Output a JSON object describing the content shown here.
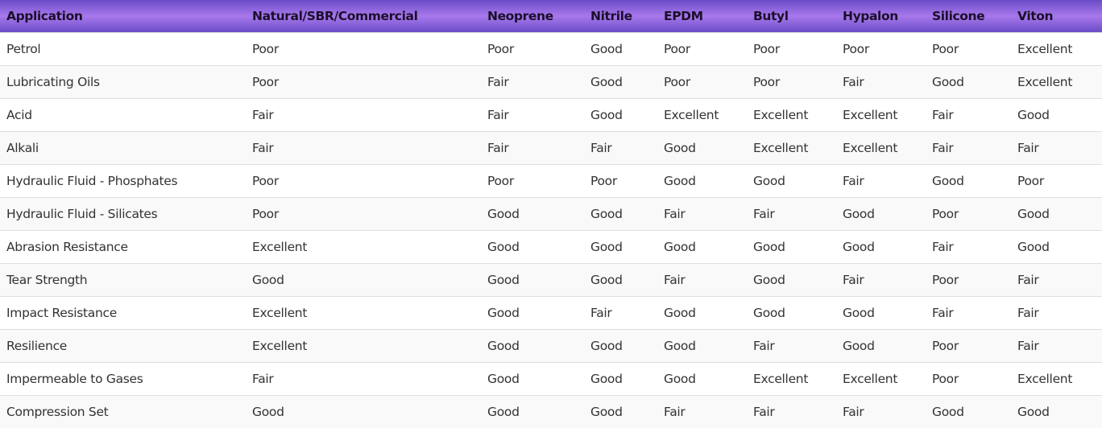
{
  "table": {
    "headers": [
      "Application",
      "Natural/SBR/Commercial",
      "Neoprene",
      "Nitrile",
      "EPDM",
      "Butyl",
      "Hypalon",
      "Silicone",
      "Viton"
    ],
    "rows": [
      [
        "Petrol",
        "Poor",
        "Poor",
        "Good",
        "Poor",
        "Poor",
        "Poor",
        "Poor",
        "Excellent"
      ],
      [
        "Lubricating Oils",
        "Poor",
        "Fair",
        "Good",
        "Poor",
        "Poor",
        "Fair",
        "Good",
        "Excellent"
      ],
      [
        "Acid",
        "Fair",
        "Fair",
        "Good",
        "Excellent",
        "Excellent",
        "Excellent",
        "Fair",
        "Good"
      ],
      [
        "Alkali",
        "Fair",
        "Fair",
        "Fair",
        "Good",
        "Excellent",
        "Excellent",
        "Fair",
        "Fair"
      ],
      [
        "Hydraulic Fluid - Phosphates",
        "Poor",
        "Poor",
        "Poor",
        "Good",
        "Good",
        "Fair",
        "Good",
        "Poor"
      ],
      [
        "Hydraulic Fluid - Silicates",
        "Poor",
        "Good",
        "Good",
        "Fair",
        "Fair",
        "Good",
        "Poor",
        "Good"
      ],
      [
        "Abrasion Resistance",
        "Excellent",
        "Good",
        "Good",
        "Good",
        "Good",
        "Good",
        "Fair",
        "Good"
      ],
      [
        "Tear Strength",
        "Good",
        "Good",
        "Good",
        "Fair",
        "Good",
        "Fair",
        "Poor",
        "Fair"
      ],
      [
        "Impact Resistance",
        "Excellent",
        "Good",
        "Fair",
        "Good",
        "Good",
        "Good",
        "Fair",
        "Fair"
      ],
      [
        "Resilience",
        "Excellent",
        "Good",
        "Good",
        "Good",
        "Fair",
        "Good",
        "Poor",
        "Fair"
      ],
      [
        "Impermeable to Gases",
        "Fair",
        "Good",
        "Good",
        "Good",
        "Excellent",
        "Excellent",
        "Poor",
        "Excellent"
      ],
      [
        "Compression Set",
        "Good",
        "Good",
        "Good",
        "Fair",
        "Fair",
        "Fair",
        "Good",
        "Good"
      ]
    ]
  }
}
